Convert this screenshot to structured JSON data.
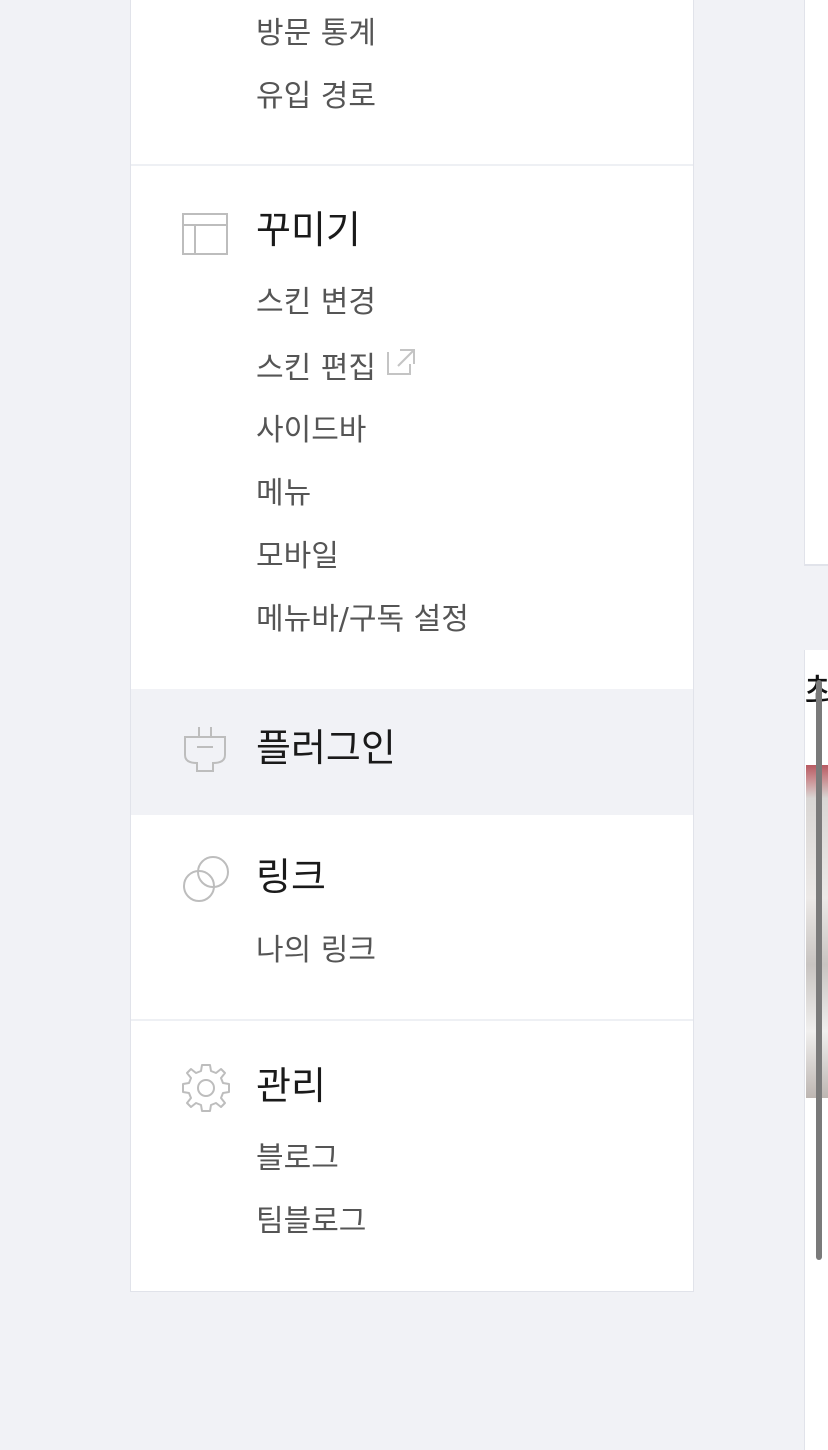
{
  "sidebar": {
    "stats": {
      "items": [
        "방문 통계",
        "유입 경로"
      ]
    },
    "decorate": {
      "title": "꾸미기",
      "icon": "layout-icon",
      "items": [
        "스킨 변경",
        "스킨 편집",
        "사이드바",
        "메뉴",
        "모바일",
        "메뉴바/구독 설정"
      ],
      "external_icon": "external-link-icon"
    },
    "plugin": {
      "title": "플러그인",
      "icon": "plug-icon"
    },
    "link": {
      "title": "링크",
      "icon": "link-icon",
      "items": [
        "나의 링크"
      ]
    },
    "manage": {
      "title": "관리",
      "icon": "gear-icon",
      "items": [
        "블로그",
        "팀블로그"
      ]
    }
  },
  "right": {
    "heading": "최"
  },
  "colors": {
    "page_bg": "#f1f2f6",
    "panel_bg": "#ffffff",
    "active_bg": "#f1f2f6",
    "title_text": "#1a1a1a",
    "item_text": "#555555",
    "icon_stroke": "#bdbdbd"
  }
}
